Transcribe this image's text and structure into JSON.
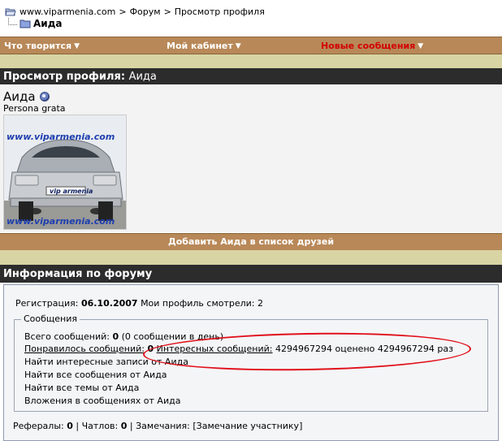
{
  "breadcrumb": {
    "site": "www.viparmenia.com",
    "sep1": ">",
    "forum": "Форум",
    "sep2": ">",
    "page": "Просмотр профиля",
    "current": "Аида"
  },
  "navbar": {
    "item1": "Что творится",
    "item2": "Мой кабинет",
    "item3": "Новые сообщения"
  },
  "profile_header": {
    "title": "Просмотр профиля",
    "colon": ":",
    "name": "Аида"
  },
  "profile": {
    "name": "Аида",
    "rank": "Persona grata",
    "avatar_text_top": "www.viparmenia.com",
    "avatar_text_plate": "vip armenia",
    "avatar_text_bottom": "www.viparmenia.com"
  },
  "add_friend_label": "Добавить Аида в список друзей",
  "forum_info": {
    "title": "Информация по форуму",
    "reg_label": "Регистрация:",
    "reg_date": "06.10.2007",
    "views_label": "Мои профиль смотрели:",
    "views_value": "2",
    "messages_legend": "Сообщения",
    "total_label": "Всего сообщений:",
    "total_value": "0",
    "total_rate": "(0 сообщении в день)",
    "liked_label": "Понравилось сообщений:",
    "liked_value": "0",
    "interesting_label": "Интересных сообщений:",
    "interesting_rest": "4294967294 оценено 4294967294 раз",
    "find_interesting": "Найти интересные записи от Аида",
    "find_all_posts": "Найти все сообщения от Аида",
    "find_all_topics": "Найти все темы от Аида",
    "attachments": "Вложения в сообщениях от Аида",
    "referrals_label": "Рефералы:",
    "referrals_value": "0",
    "chatlov_label": "Чатлов:",
    "chatlov_value": "0",
    "warnings_label": "Замечания:",
    "warning_link": "[Замечание участнику]",
    "pipe": "|"
  },
  "colors": {
    "nav_bg": "#b88858",
    "header_bg": "#2c2c2c",
    "sand": "#d8d4a4",
    "new_messages": "#d30000",
    "annotation": "#e0101a"
  }
}
